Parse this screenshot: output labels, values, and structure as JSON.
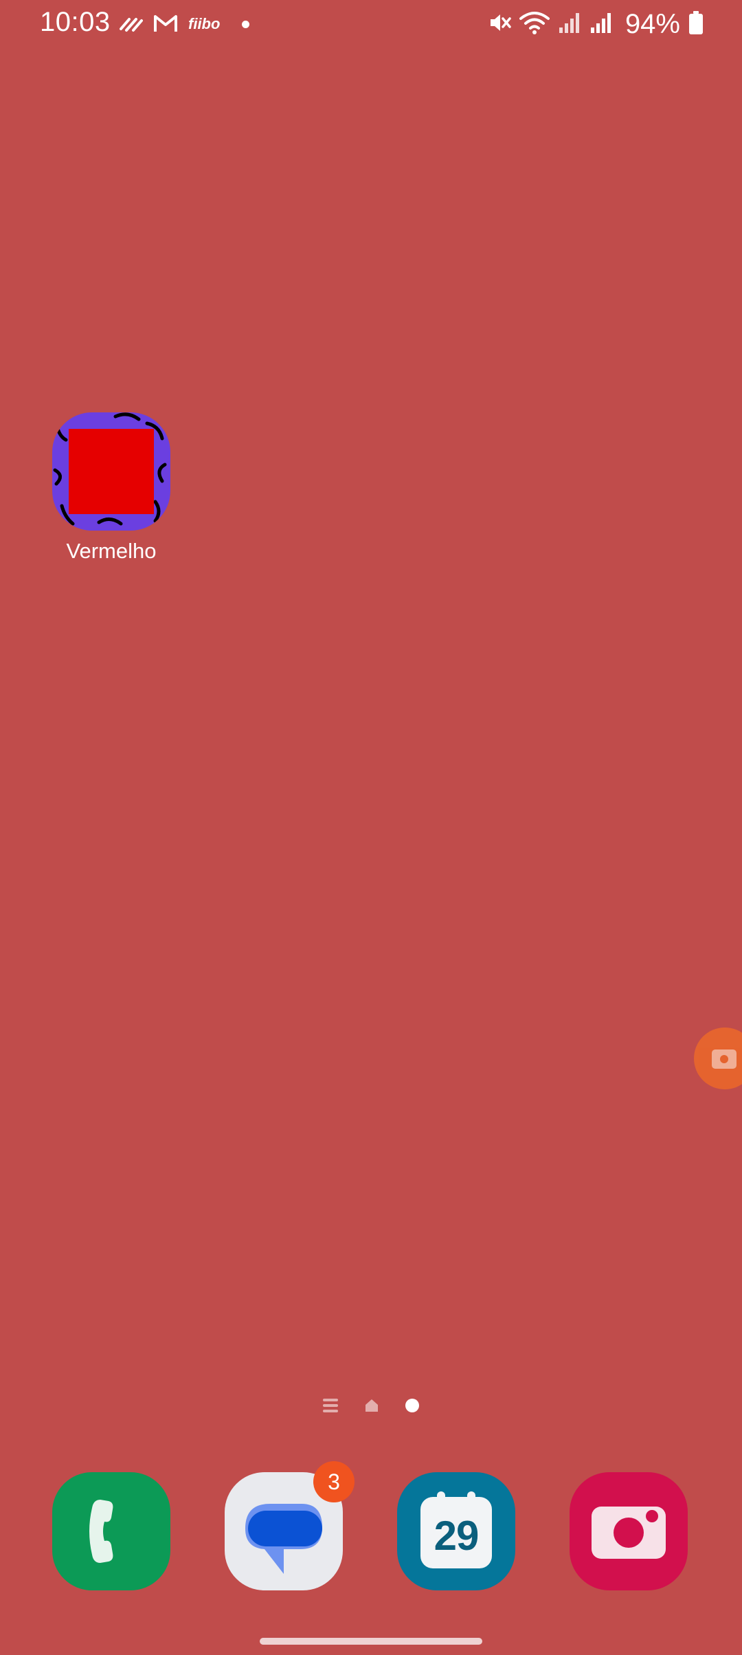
{
  "status_bar": {
    "time": "10:03",
    "notification_label": "fiibo",
    "battery": "94%"
  },
  "home": {
    "apps": [
      {
        "label": "Vermelho",
        "icon": "vermelho-app-icon"
      }
    ]
  },
  "dock": {
    "items": [
      {
        "name": "phone",
        "icon": "phone-icon"
      },
      {
        "name": "messages",
        "icon": "messages-icon",
        "badge": "3"
      },
      {
        "name": "calendar",
        "icon": "calendar-icon",
        "date": "29"
      },
      {
        "name": "camera",
        "icon": "camera-icon"
      }
    ]
  },
  "colors": {
    "wallpaper": "#c04c4b",
    "phone": "#0c9a56",
    "messages": "#e9eaee",
    "calendar": "#05769a",
    "camera": "#d2104d",
    "badge": "#f0531f",
    "floating_button": "#e7652d"
  }
}
